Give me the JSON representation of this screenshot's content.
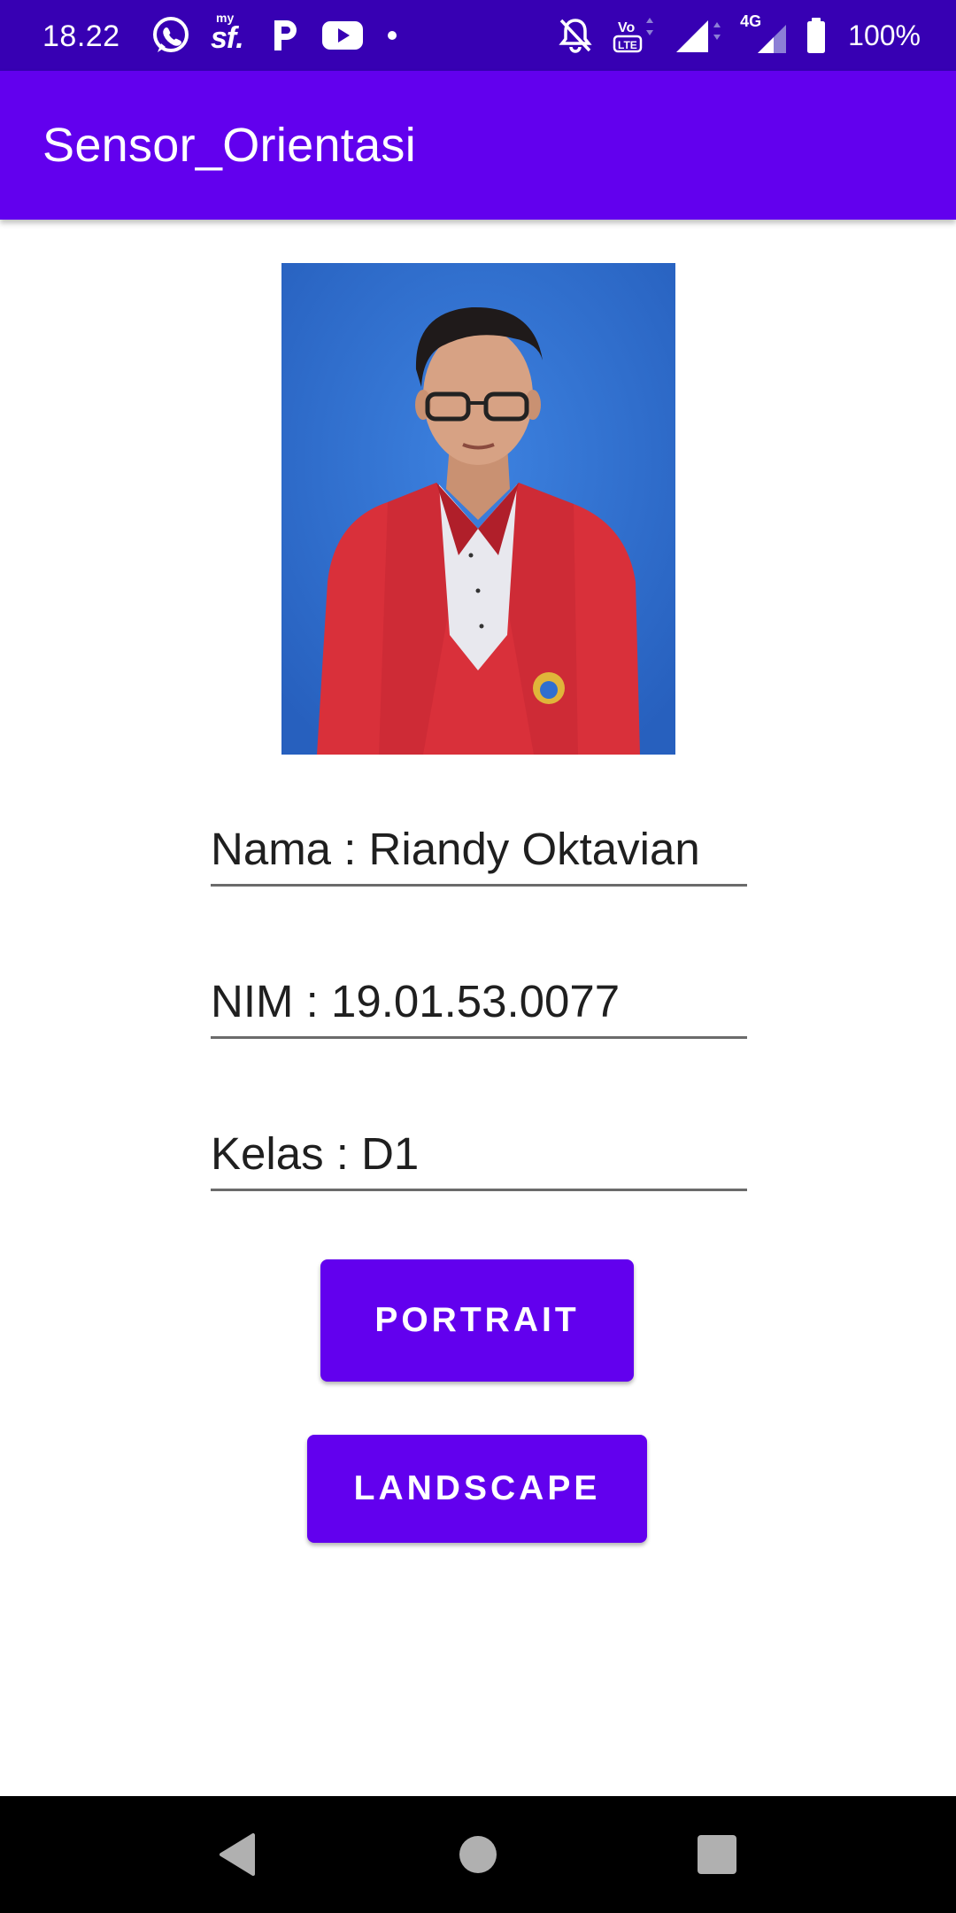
{
  "status_bar": {
    "time": "18.22",
    "battery_percent": "100%",
    "network_label": "4G",
    "left_icons": [
      "whatsapp-icon",
      "mysf-icon",
      "p-app-icon",
      "youtube-icon",
      "notification-dot"
    ],
    "right_icons": [
      "notifications-off-icon",
      "volte-icon",
      "signal-icon",
      "signal-4g-icon",
      "battery-icon"
    ],
    "mysf_small": "my",
    "mysf_large": "sf."
  },
  "app_bar": {
    "title": "Sensor_Orientasi"
  },
  "form": {
    "nama": "Nama : Riandy Oktavian",
    "nim": "NIM : 19.01.53.0077",
    "kelas": "Kelas : D1"
  },
  "buttons": {
    "portrait": "PORTRAIT",
    "landscape": "LANDSCAPE"
  },
  "nav_bar": {
    "items": [
      "back-icon",
      "home-icon",
      "recents-icon"
    ]
  },
  "colors": {
    "status_bar": "#3700b3",
    "primary": "#6200ee",
    "photo_background": "#2f6fd0",
    "jacket": "#d9303a"
  }
}
